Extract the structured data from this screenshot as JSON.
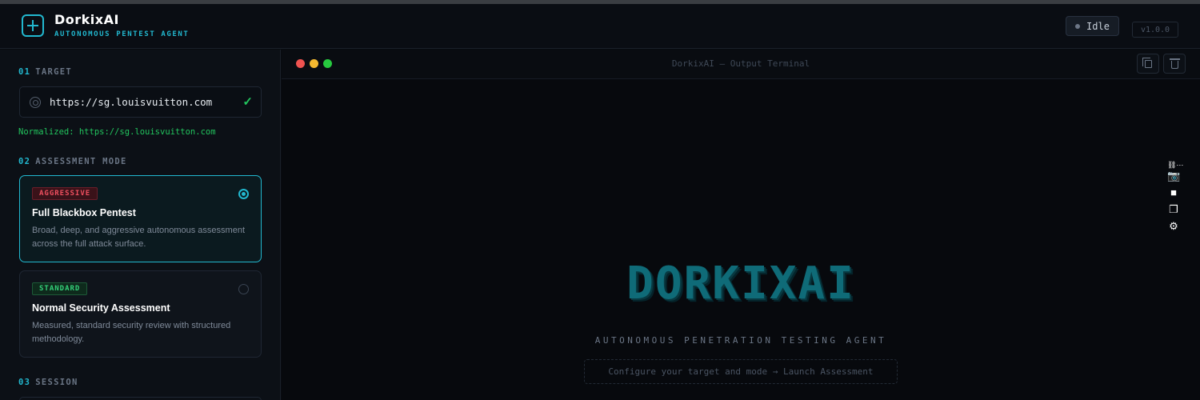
{
  "header": {
    "brand_name": "DorkixAI",
    "brand_subtitle": "AUTONOMOUS PENTEST AGENT",
    "status": "Idle",
    "version": "v1.0.0"
  },
  "sidebar": {
    "target": {
      "num": "01",
      "title": "TARGET",
      "url": "https://sg.louisvuitton.com",
      "check": "✓",
      "normalized": "Normalized: https://sg.louisvuitton.com"
    },
    "mode": {
      "num": "02",
      "title": "ASSESSMENT MODE",
      "options": [
        {
          "badge": "AGGRESSIVE",
          "name": "Full Blackbox Pentest",
          "description": "Broad, deep, and aggressive autonomous assessment across the full attack surface.",
          "selected": true
        },
        {
          "badge": "STANDARD",
          "name": "Normal Security Assessment",
          "description": "Measured, standard security review with structured methodology.",
          "selected": false
        }
      ]
    },
    "session": {
      "num": "03",
      "title": "SESSION"
    }
  },
  "terminal": {
    "title": "DorkixAI — Output Terminal",
    "logo_text": "DORKIXAI",
    "tagline": "AUTONOMOUS PENETRATION TESTING AGENT",
    "hint": "Configure your target and mode → Launch Assessment"
  },
  "icons": {
    "logo": "plus-square-icon",
    "target": "crosshair-icon",
    "copy": "copy-icon",
    "trash": "trash-icon",
    "camera": "camera-icon",
    "video": "video-icon",
    "window": "window-icon",
    "settings": "gear-icon"
  },
  "colors": {
    "accent": "#22b8cf",
    "success": "#22c55e",
    "danger": "#f05060",
    "background": "#080b10"
  }
}
